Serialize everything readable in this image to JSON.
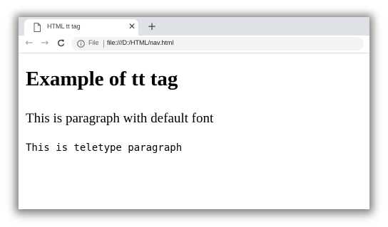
{
  "browser": {
    "tab": {
      "title": "HTML tt tag",
      "icon": "page-icon",
      "close_icon": "close-icon"
    },
    "new_tab_icon": "plus-icon",
    "toolbar": {
      "back_icon": "arrow-left-icon",
      "forward_icon": "arrow-right-icon",
      "reload_icon": "reload-icon",
      "info_icon": "info-icon",
      "scheme_label": "File",
      "url": "file:///D:/HTML/nav.html"
    }
  },
  "page": {
    "heading": "Example of tt tag",
    "paragraph_default": "This is paragraph with default font",
    "paragraph_teletype": "This is teletype paragraph"
  }
}
